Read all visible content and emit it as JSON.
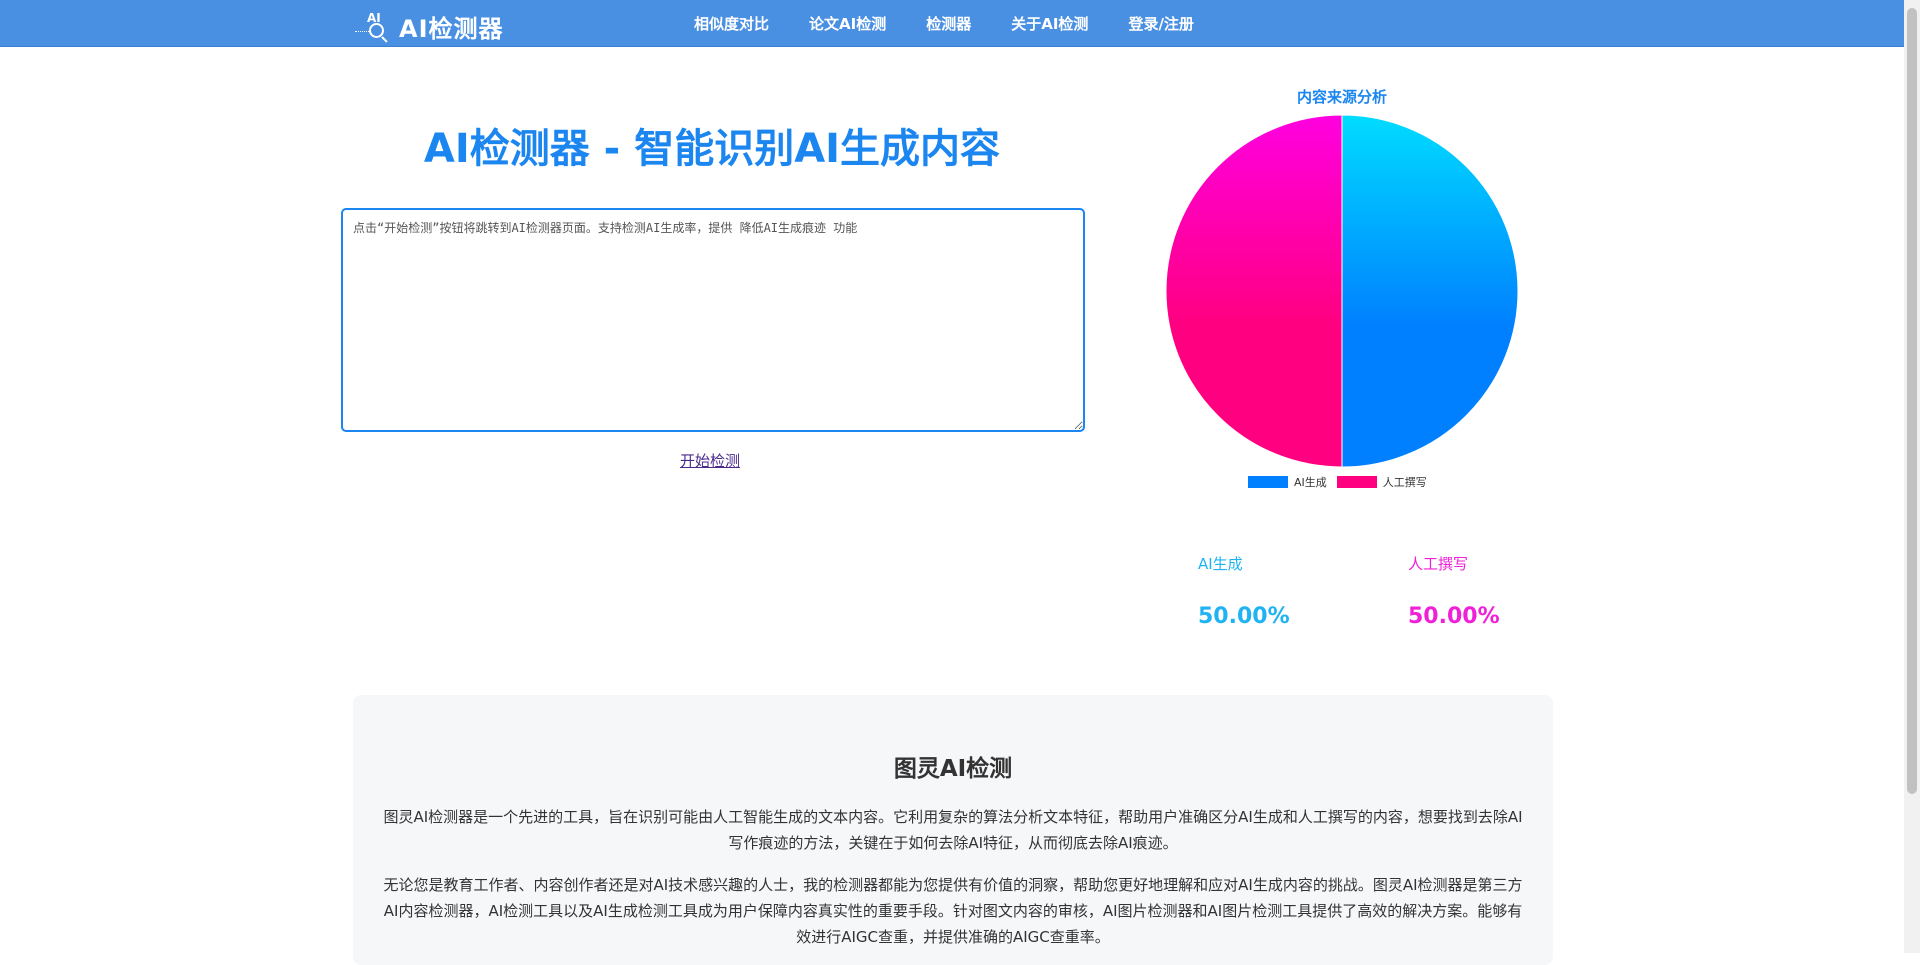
{
  "nav": {
    "logo_small": "AI",
    "logo_text": "AI检测器",
    "items": [
      {
        "label": "相似度对比"
      },
      {
        "label": "论文AI检测"
      },
      {
        "label": "检测器"
      },
      {
        "label": "关于AI检测"
      },
      {
        "label": "登录/注册"
      }
    ],
    "color": "#4a90e2"
  },
  "hero": {
    "title": "AI检测器 - 智能识别AI生成内容",
    "input_placeholder": "点击“开始检测”按钮将跳转到AI检测器页面。支持检测AI生成率，提供 降低AI生成痕迹 功能",
    "input_value": "",
    "start_label": "开始检测"
  },
  "chart_data": {
    "type": "pie",
    "title": "内容来源分析",
    "categories": [
      "AI生成",
      "人工撰写"
    ],
    "values": [
      50,
      50
    ],
    "colors": [
      [
        "#00dcff",
        "#0080ff"
      ],
      [
        "#ff00e0",
        "#ff0080"
      ]
    ],
    "legend_position": "bottom"
  },
  "stats": [
    {
      "label": "AI生成",
      "value": "50.00%",
      "color": "#1fb3f3"
    },
    {
      "label": "人工撰写",
      "value": "50.00%",
      "color": "#f01fd8"
    }
  ],
  "about": {
    "title": "图灵AI检测",
    "paragraphs": [
      "图灵AI检测器是一个先进的工具，旨在识别可能由人工智能生成的文本内容。它利用复杂的算法分析文本特征，帮助用户准确区分AI生成和人工撰写的内容，想要找到去除AI写作痕迹的方法，关键在于如何去除AI特征，从而彻底去除AI痕迹。",
      "无论您是教育工作者、内容创作者还是对AI技术感兴趣的人士，我的检测器都能为您提供有价值的洞察，帮助您更好地理解和应对AI生成内容的挑战。图灵AI检测器是第三方AI内容检测器，AI检测工具以及AI生成检测工具成为用户保障内容真实性的重要手段。针对图文内容的审核，AI图片检测器和AI图片检测工具提供了高效的解决方案。能够有效进行AIGC查重，并提供准确的AIGC查重率。"
    ]
  }
}
